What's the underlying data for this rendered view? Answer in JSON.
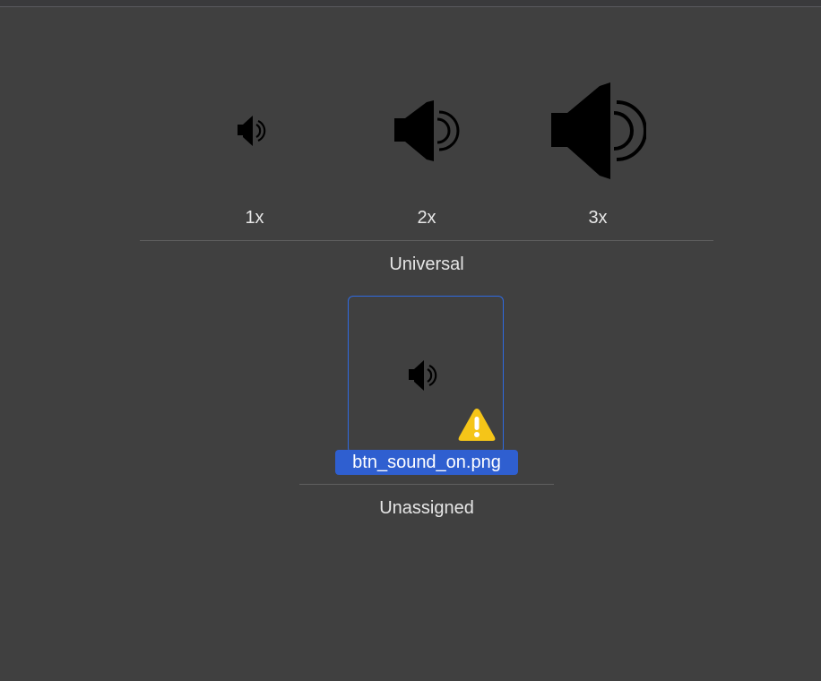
{
  "slots": [
    {
      "label": "1x",
      "icon": "speaker-icon"
    },
    {
      "label": "2x",
      "icon": "speaker-icon"
    },
    {
      "label": "3x",
      "icon": "speaker-icon"
    }
  ],
  "groups": {
    "universal_label": "Universal",
    "unassigned_label": "Unassigned"
  },
  "unassigned_item": {
    "filename": "btn_sound_on.png",
    "icon": "speaker-icon",
    "badge": "warning-icon"
  },
  "colors": {
    "background": "#404040",
    "selection": "#2f5fd0",
    "warning": "#f5c518"
  }
}
